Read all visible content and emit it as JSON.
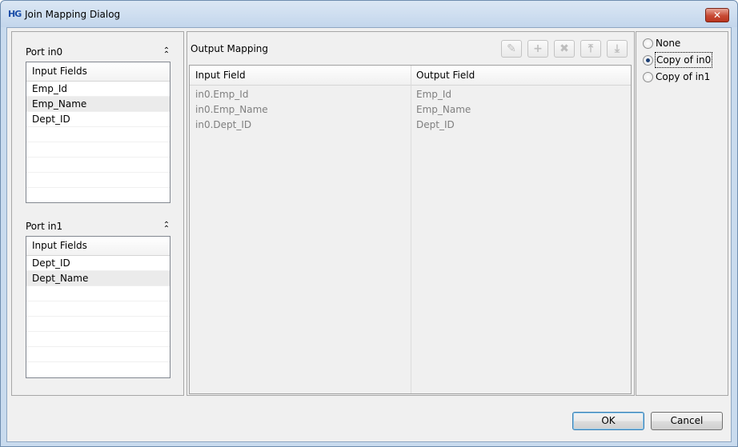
{
  "window": {
    "title": "Join Mapping Dialog",
    "app_icon": "HG",
    "close_glyph": "✕"
  },
  "ports": [
    {
      "title": "Port in0",
      "header": "Input Fields",
      "fields": [
        "Emp_Id",
        "Emp_Name",
        "Dept_ID"
      ],
      "selected_index": 1
    },
    {
      "title": "Port in1",
      "header": "Input Fields",
      "fields": [
        "Dept_ID",
        "Dept_Name"
      ],
      "selected_index": 1
    }
  ],
  "output": {
    "title": "Output Mapping",
    "toolbar_icons": [
      "edit-icon",
      "add-icon",
      "delete-icon",
      "move-up-icon",
      "move-down-icon"
    ],
    "columns": [
      "Input Field",
      "Output Field"
    ],
    "rows": [
      [
        "in0.Emp_Id",
        "Emp_Id"
      ],
      [
        "in0.Emp_Name",
        "Emp_Name"
      ],
      [
        "in0.Dept_ID",
        "Dept_ID"
      ]
    ]
  },
  "copy_options": {
    "options": [
      "None",
      "Copy of in0",
      "Copy of in1"
    ],
    "selected": "Copy of in0"
  },
  "buttons": {
    "ok": "OK",
    "cancel": "Cancel"
  }
}
